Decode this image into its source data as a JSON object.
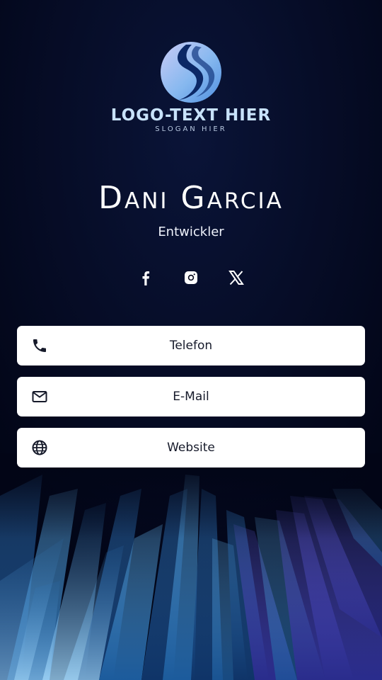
{
  "logo": {
    "text": "LOGO-TEXT HIER",
    "slogan": "SLOGAN HIER",
    "icon": "logo-s-sphere-icon"
  },
  "profile": {
    "name": "Dani Garcia",
    "role": "Entwickler"
  },
  "social": [
    {
      "name": "Facebook",
      "icon": "facebook-icon"
    },
    {
      "name": "Instagram",
      "icon": "instagram-icon"
    },
    {
      "name": "X",
      "icon": "x-icon"
    }
  ],
  "buttons": [
    {
      "label": "Telefon",
      "icon": "phone-icon"
    },
    {
      "label": "E-Mail",
      "icon": "mail-icon"
    },
    {
      "label": "Website",
      "icon": "globe-icon"
    }
  ],
  "colors": {
    "background": "#03061a",
    "button_bg": "#ffffff",
    "button_text": "#161a2a",
    "logo_text": "#c8e2fb",
    "accent_blue": "#5aa8e8",
    "accent_violet": "#5a50c8"
  }
}
